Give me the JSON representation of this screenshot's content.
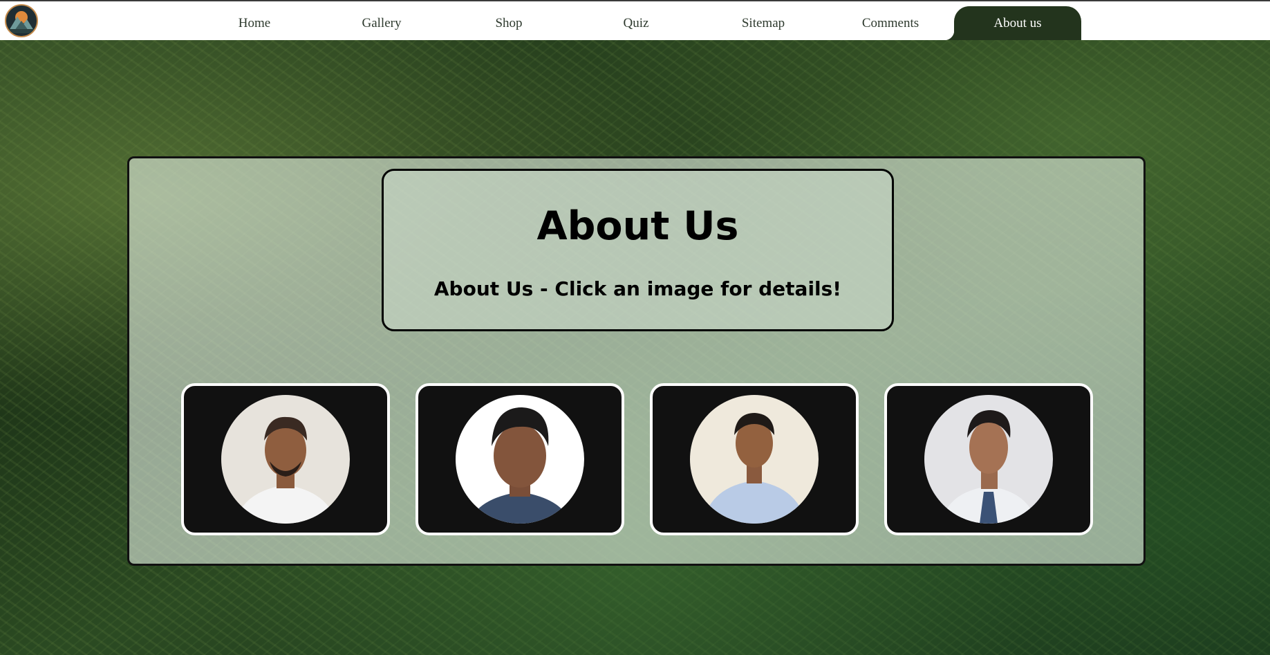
{
  "nav": {
    "logo_icon": "mountain-logo-icon",
    "items": [
      {
        "label": "Home",
        "active": false
      },
      {
        "label": "Gallery",
        "active": false
      },
      {
        "label": "Shop",
        "active": false
      },
      {
        "label": "Quiz",
        "active": false
      },
      {
        "label": "Sitemap",
        "active": false
      },
      {
        "label": "Comments",
        "active": false
      },
      {
        "label": "About us",
        "active": true
      }
    ]
  },
  "main": {
    "title": "About Us",
    "subtitle": "About Us - Click an image for details!",
    "members": [
      {
        "portrait_icon": "member-portrait-icon",
        "bg": "#e7e3dc",
        "shirt": "#f4f4f4",
        "tie": ""
      },
      {
        "portrait_icon": "member-portrait-icon",
        "bg": "#ffffff",
        "shirt": "#3a4d6a",
        "tie": ""
      },
      {
        "portrait_icon": "member-portrait-icon",
        "bg": "#efe9dc",
        "shirt": "#b9cbe6",
        "tie": ""
      },
      {
        "portrait_icon": "member-portrait-icon",
        "bg": "#e3e3e6",
        "shirt": "#eef0f3",
        "tie": "#3b5276"
      }
    ]
  }
}
